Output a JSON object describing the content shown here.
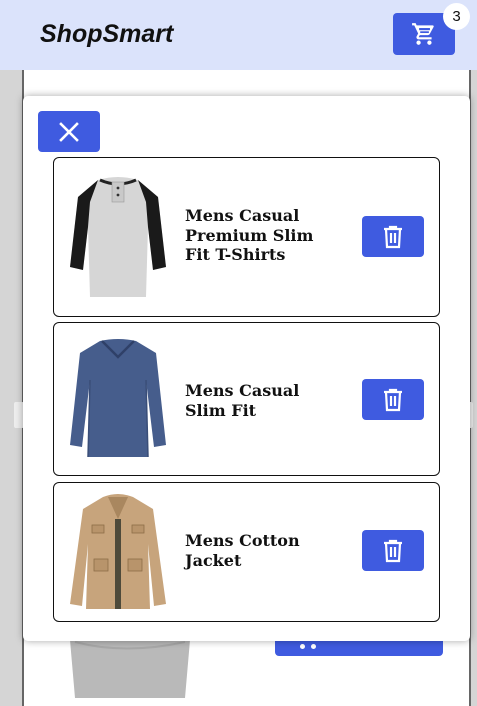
{
  "header": {
    "logo": "ShopSmart",
    "cart_icon": "cart-icon",
    "cart_count": "3"
  },
  "modal": {
    "close_icon": "close-icon",
    "items": [
      {
        "title": "Mens Casual Premium Slim Fit T-Shirts",
        "image": "raglan-henley-shirt-image",
        "delete_icon": "trash-icon"
      },
      {
        "title": "Mens Casual Slim Fit",
        "image": "navy-long-sleeve-shirt-image",
        "delete_icon": "trash-icon"
      },
      {
        "title": "Mens Cotton Jacket",
        "image": "khaki-cotton-jacket-image",
        "delete_icon": "trash-icon"
      }
    ]
  },
  "colors": {
    "accent": "#3f5be0",
    "header_bg": "#dbe3fb"
  }
}
